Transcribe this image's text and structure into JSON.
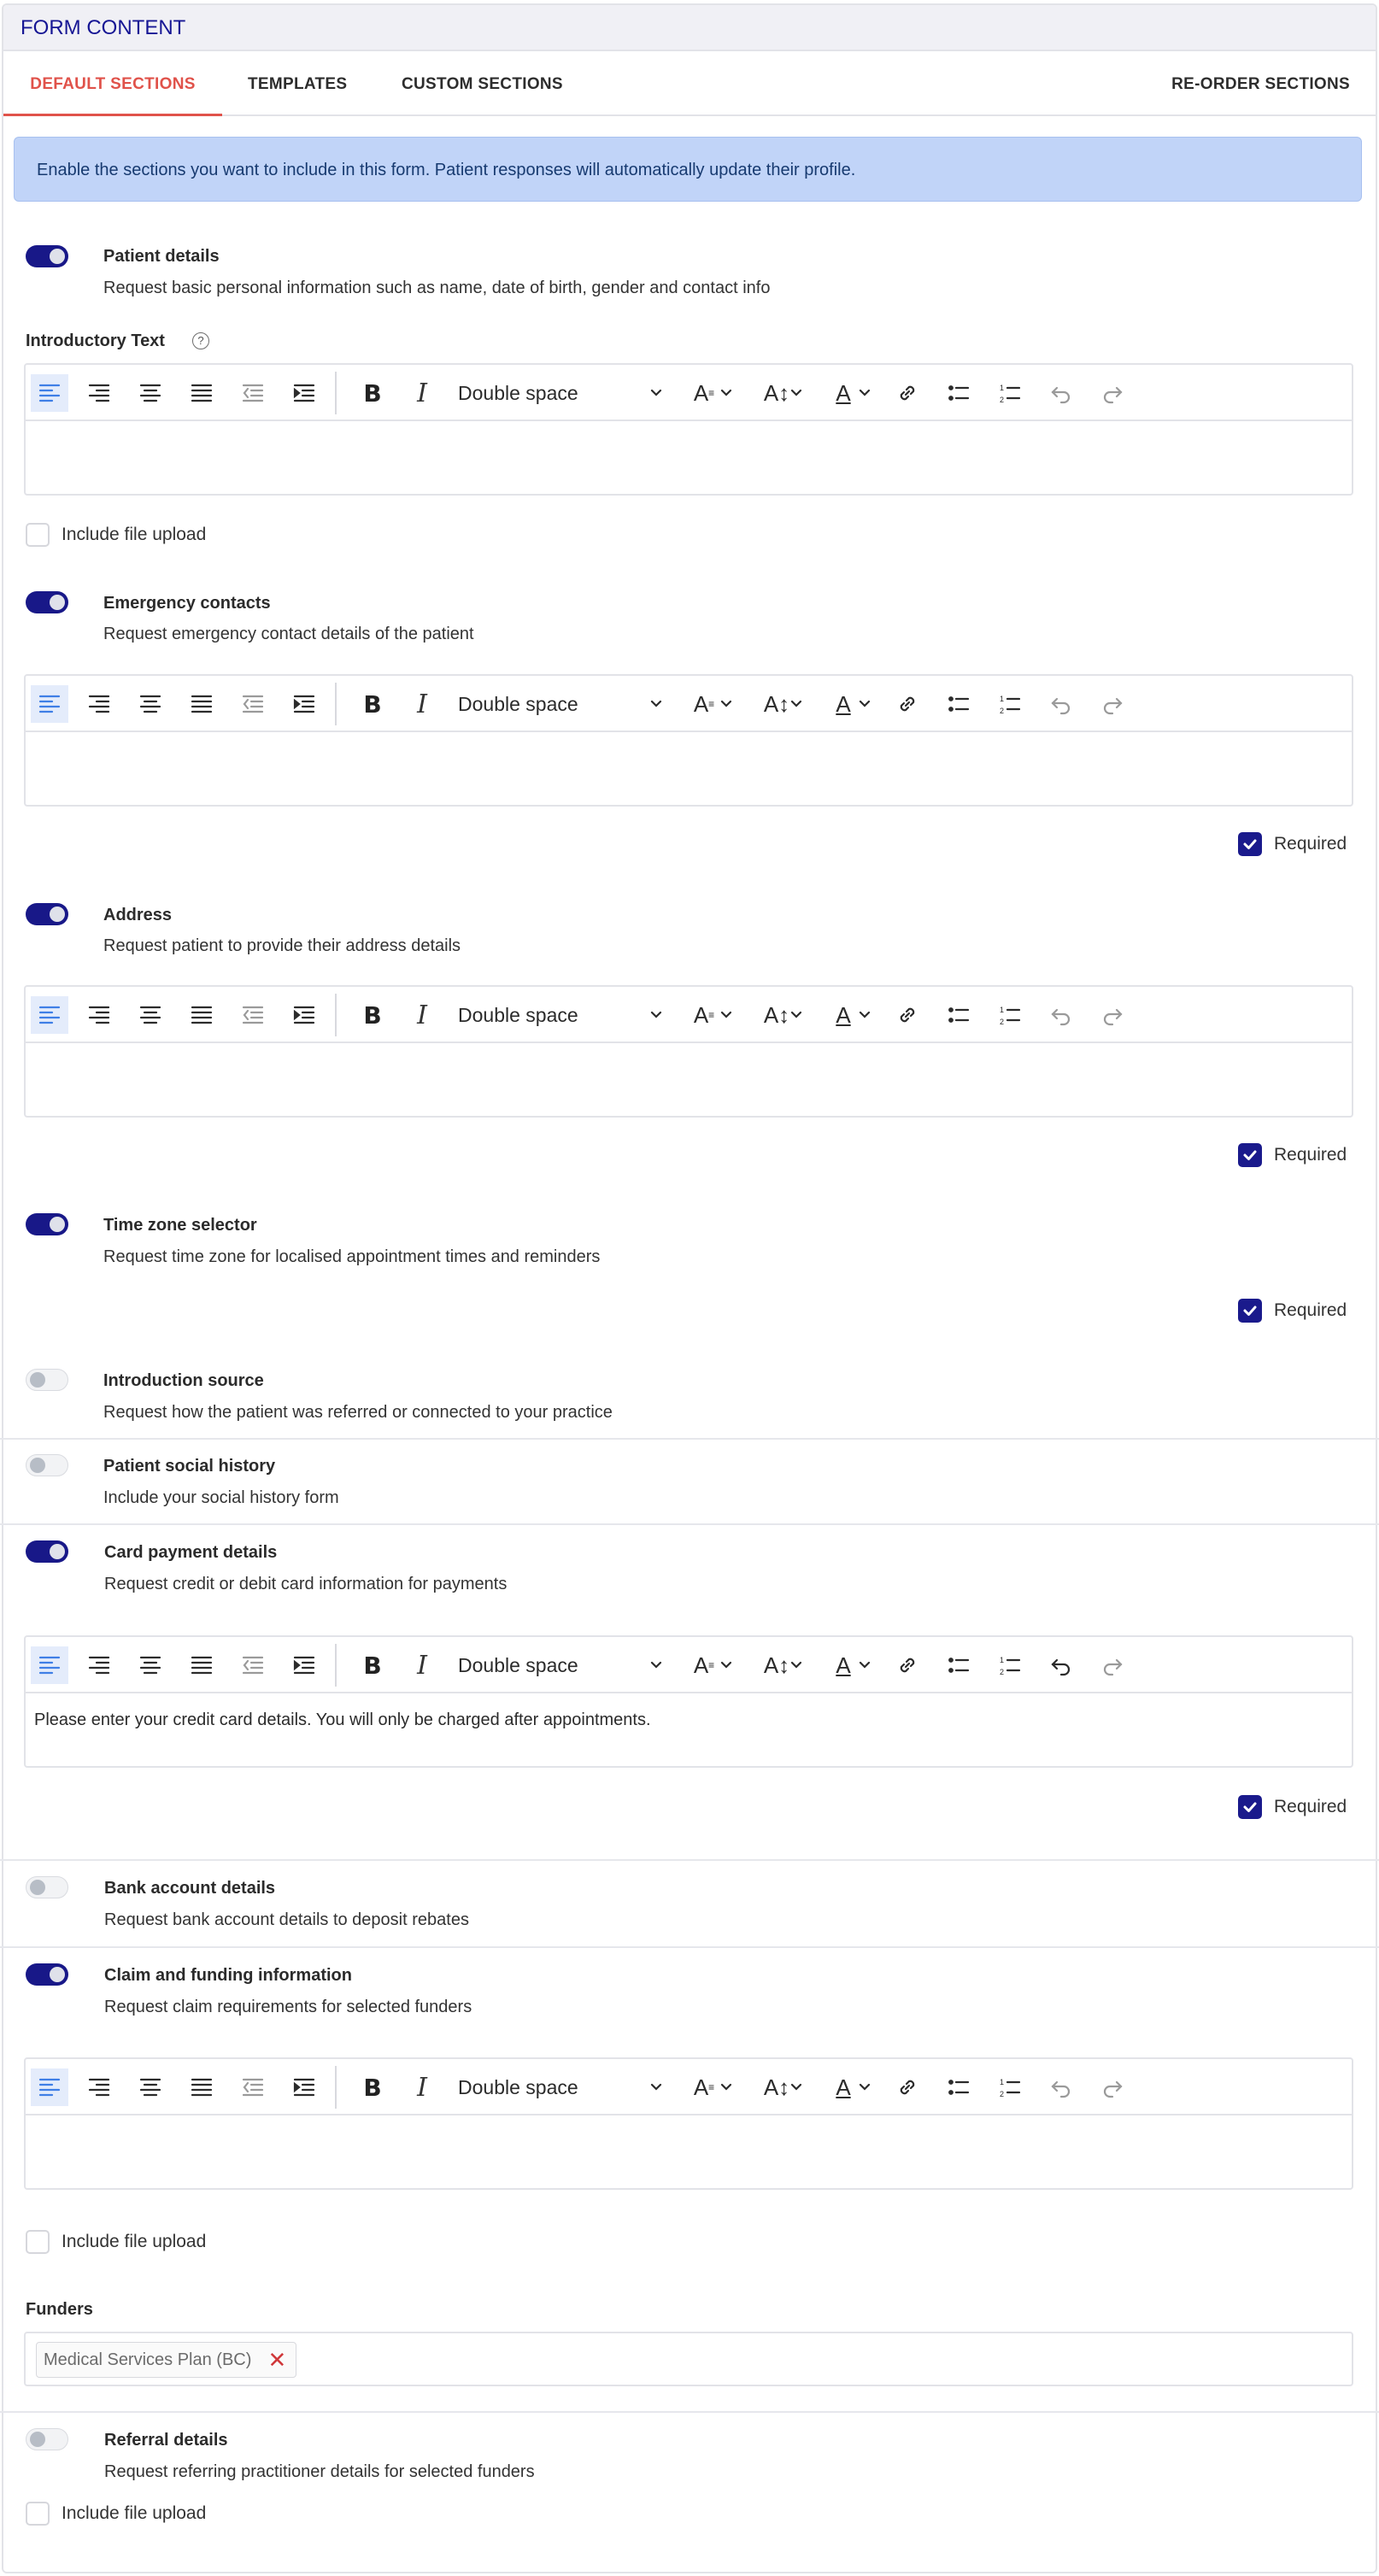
{
  "header": {
    "title": "FORM CONTENT"
  },
  "tabs": {
    "default": "DEFAULT SECTIONS",
    "templates": "TEMPLATES",
    "custom": "CUSTOM SECTIONS",
    "reorder": "RE-ORDER SECTIONS"
  },
  "banner": "Enable the sections you want to include in this form. Patient responses will automatically update their profile.",
  "editor": {
    "line_spacing": "Double space"
  },
  "sections": {
    "patient_details": {
      "title": "Patient details",
      "desc": "Request basic personal information such as name, date of birth, gender and contact info",
      "enabled": true
    },
    "emergency_contacts": {
      "title": "Emergency contacts",
      "desc": "Request emergency contact details of the patient",
      "enabled": true
    },
    "address": {
      "title": "Address",
      "desc": "Request patient to provide their address details",
      "enabled": true
    },
    "time_zone": {
      "title": "Time zone selector",
      "desc": "Request time zone for localised appointment times and reminders",
      "enabled": true
    },
    "introduction_source": {
      "title": "Introduction source",
      "desc": "Request how the patient was referred or connected to your practice",
      "enabled": false
    },
    "social_history": {
      "title": "Patient social history",
      "desc": "Include your social history form",
      "enabled": false
    },
    "card_payment": {
      "title": "Card payment details",
      "desc": "Request credit or debit card information for payments",
      "enabled": true,
      "editor_text": "Please enter your credit card details. You will only be charged after appointments."
    },
    "bank_account": {
      "title": "Bank account details",
      "desc": "Request bank account details to deposit rebates",
      "enabled": false
    },
    "claim_funding": {
      "title": "Claim and funding information",
      "desc": "Request claim requirements for selected funders",
      "enabled": true
    },
    "referral": {
      "title": "Referral details",
      "desc": "Request referring practitioner details for selected funders",
      "enabled": false
    }
  },
  "labels": {
    "introductory_text": "Introductory Text",
    "include_file_upload": "Include file upload",
    "required": "Required",
    "funders": "Funders"
  },
  "funders": [
    "Medical Services Plan (BC)"
  ],
  "icons": [
    "help-icon",
    "align-left-icon",
    "align-right-icon",
    "align-center-icon",
    "align-justify-icon",
    "outdent-icon",
    "indent-icon",
    "bold-icon",
    "italic-icon",
    "chevron-down-icon",
    "font-size-icon",
    "line-height-icon",
    "font-color-icon",
    "link-icon",
    "bullet-list-icon",
    "numbered-list-icon",
    "undo-icon",
    "redo-icon",
    "check-icon",
    "close-icon"
  ],
  "colors": {
    "accent": "#181888",
    "active_tab": "#e0524a",
    "banner_bg": "#c1d4f8",
    "remove": "#d0383a"
  }
}
